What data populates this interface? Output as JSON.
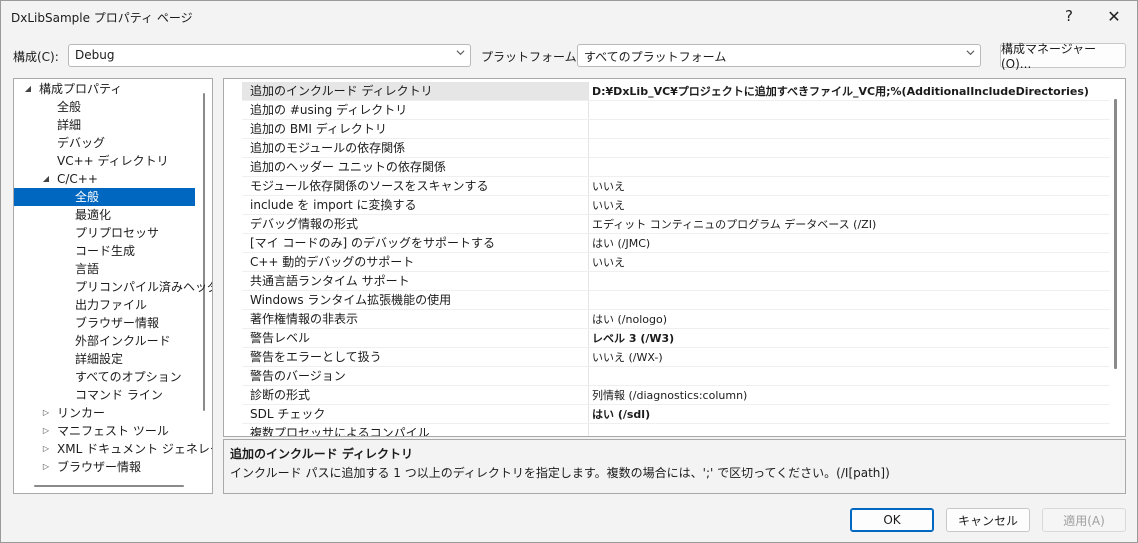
{
  "window": {
    "title": "DxLibSample プロパティ ページ",
    "help_glyph": "?",
    "close_glyph": "✕"
  },
  "config": {
    "label": "構成(C):",
    "value": "Debug",
    "platform_label": "プラットフォーム(P):",
    "platform_value": "すべてのプラットフォーム",
    "manager_button": "構成マネージャー(O)..."
  },
  "tree": {
    "items": [
      {
        "label": "構成プロパティ",
        "toggle": "◢",
        "level": 0
      },
      {
        "label": "全般",
        "toggle": "",
        "level": 1
      },
      {
        "label": "詳細",
        "toggle": "",
        "level": 1
      },
      {
        "label": "デバッグ",
        "toggle": "",
        "level": 1
      },
      {
        "label": "VC++ ディレクトリ",
        "toggle": "",
        "level": 1
      },
      {
        "label": "C/C++",
        "toggle": "◢",
        "level": 1
      },
      {
        "label": "全般",
        "toggle": "",
        "level": 2,
        "selected": true
      },
      {
        "label": "最適化",
        "toggle": "",
        "level": 2
      },
      {
        "label": "プリプロセッサ",
        "toggle": "",
        "level": 2
      },
      {
        "label": "コード生成",
        "toggle": "",
        "level": 2
      },
      {
        "label": "言語",
        "toggle": "",
        "level": 2
      },
      {
        "label": "プリコンパイル済みヘッダー",
        "toggle": "",
        "level": 2
      },
      {
        "label": "出力ファイル",
        "toggle": "",
        "level": 2
      },
      {
        "label": "ブラウザー情報",
        "toggle": "",
        "level": 2
      },
      {
        "label": "外部インクルード",
        "toggle": "",
        "level": 2
      },
      {
        "label": "詳細設定",
        "toggle": "",
        "level": 2
      },
      {
        "label": "すべてのオプション",
        "toggle": "",
        "level": 2
      },
      {
        "label": "コマンド ライン",
        "toggle": "",
        "level": 2
      },
      {
        "label": "リンカー",
        "toggle": "▷",
        "level": 1
      },
      {
        "label": "マニフェスト ツール",
        "toggle": "▷",
        "level": 1
      },
      {
        "label": "XML ドキュメント ジェネレーター",
        "toggle": "▷",
        "level": 1
      },
      {
        "label": "ブラウザー情報",
        "toggle": "▷",
        "level": 1
      }
    ]
  },
  "properties": [
    {
      "name": "追加のインクルード ディレクトリ",
      "value": "D:¥DxLib_VC¥プロジェクトに追加すべきファイル_VC用;%(AdditionalIncludeDirectories)",
      "bold": true,
      "selected": true
    },
    {
      "name": "追加の #using ディレクトリ",
      "value": ""
    },
    {
      "name": "追加の BMI ディレクトリ",
      "value": ""
    },
    {
      "name": "追加のモジュールの依存関係",
      "value": ""
    },
    {
      "name": "追加のヘッダー ユニットの依存関係",
      "value": ""
    },
    {
      "name": "モジュール依存関係のソースをスキャンする",
      "value": "いいえ"
    },
    {
      "name": "include を import に変換する",
      "value": "いいえ"
    },
    {
      "name": "デバッグ情報の形式",
      "value": "エディット コンティニュのプログラム データベース (/ZI)"
    },
    {
      "name": "[マイ コードのみ] のデバッグをサポートする",
      "value": "はい (/JMC)"
    },
    {
      "name": "C++ 動的デバッグのサポート",
      "value": "いいえ"
    },
    {
      "name": "共通言語ランタイム サポート",
      "value": ""
    },
    {
      "name": "Windows ランタイム拡張機能の使用",
      "value": ""
    },
    {
      "name": "著作権情報の非表示",
      "value": "はい (/nologo)"
    },
    {
      "name": "警告レベル",
      "value": "レベル 3 (/W3)",
      "bold": true
    },
    {
      "name": "警告をエラーとして扱う",
      "value": "いいえ (/WX-)"
    },
    {
      "name": "警告のバージョン",
      "value": ""
    },
    {
      "name": "診断の形式",
      "value": "列情報 (/diagnostics:column)"
    },
    {
      "name": "SDL チェック",
      "value": "はい (/sdl)",
      "bold": true
    },
    {
      "name": "複数プロセッサによるコンパイル",
      "value": ""
    }
  ],
  "description": {
    "title": "追加のインクルード ディレクトリ",
    "text": "インクルード パスに追加する 1 つ以上のディレクトリを指定します。複数の場合には、';' で区切ってください。(/I[path])"
  },
  "buttons": {
    "ok": "OK",
    "cancel": "キャンセル",
    "apply": "適用(A)"
  }
}
